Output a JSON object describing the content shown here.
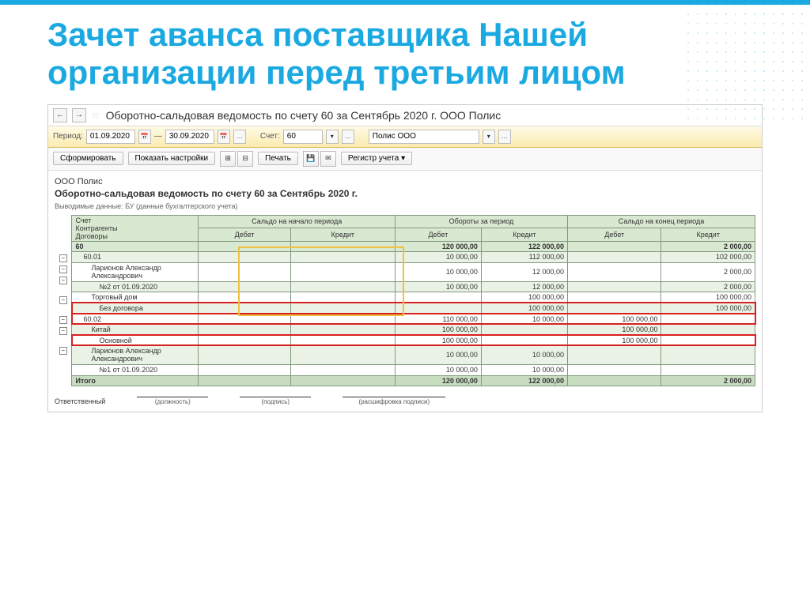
{
  "slide": {
    "title": "Зачет аванса поставщика Нашей организации перед третьим лицом"
  },
  "app": {
    "header_title": "Оборотно-сальдовая ведомость по счету 60 за Сентябрь 2020 г. ООО Полис",
    "nav_back": "←",
    "nav_fwd": "→",
    "star": "☆"
  },
  "toolbar": {
    "period_label": "Период:",
    "date_from": "01.09.2020",
    "date_sep": "—",
    "date_to": "30.09.2020",
    "account_label": "Счет:",
    "account": "60",
    "org": "Полис ООО",
    "btn_form": "Сформировать",
    "btn_settings": "Показать настройки",
    "btn_print": "Печать",
    "btn_register": "Регистр учета",
    "dots": "..."
  },
  "report": {
    "org": "ООО Полис",
    "title": "Оборотно-сальдовая ведомость по счету 60 за Сентябрь 2020 г.",
    "sub": "Выводимые данные: БУ (данные бухгалтерского учета)",
    "col_account": "Счет",
    "col_counterparty": "Контрагенты",
    "col_contracts": "Договоры",
    "grp_start": "Сальдо на начало периода",
    "grp_turn": "Обороты за период",
    "grp_end": "Сальдо на конец периода",
    "col_debit": "Дебет",
    "col_credit": "Кредит",
    "rows": [
      {
        "lvl": 0,
        "name": "60",
        "sd": "",
        "sc": "",
        "td": "120 000,00",
        "tc": "122 000,00",
        "ed": "",
        "ec": "2 000,00"
      },
      {
        "lvl": 1,
        "name": "60.01",
        "sd": "",
        "sc": "",
        "td": "10 000,00",
        "tc": "112 000,00",
        "ed": "",
        "ec": "102 000,00"
      },
      {
        "lvl": 2,
        "name": "Ларионов Александр Александрович",
        "sd": "",
        "sc": "",
        "td": "10 000,00",
        "tc": "12 000,00",
        "ed": "",
        "ec": "2 000,00"
      },
      {
        "lvl": 3,
        "name": "№2 от 01.09.2020",
        "sd": "",
        "sc": "",
        "td": "10 000,00",
        "tc": "12 000,00",
        "ed": "",
        "ec": "2 000,00"
      },
      {
        "lvl": 2,
        "name": "Торговый дом",
        "sd": "",
        "sc": "",
        "td": "",
        "tc": "100 000,00",
        "ed": "",
        "ec": "100 000,00"
      },
      {
        "lvl": 3,
        "name": "Без договора",
        "sd": "",
        "sc": "",
        "td": "",
        "tc": "100 000,00",
        "ed": "",
        "ec": "100 000,00",
        "hl": "red"
      },
      {
        "lvl": 1,
        "name": "60.02",
        "sd": "",
        "sc": "",
        "td": "110 000,00",
        "tc": "10 000,00",
        "ed": "100 000,00",
        "ec": "",
        "hl": "red"
      },
      {
        "lvl": 2,
        "name": "Китай",
        "sd": "",
        "sc": "",
        "td": "100 000,00",
        "tc": "",
        "ed": "100 000,00",
        "ec": ""
      },
      {
        "lvl": 3,
        "name": "Основной",
        "sd": "",
        "sc": "",
        "td": "100 000,00",
        "tc": "",
        "ed": "100 000,00",
        "ec": "",
        "hl": "red"
      },
      {
        "lvl": 2,
        "name": "Ларионов Александр Александрович",
        "sd": "",
        "sc": "",
        "td": "10 000,00",
        "tc": "10 000,00",
        "ed": "",
        "ec": ""
      },
      {
        "lvl": 3,
        "name": "№1 от 01.09.2020",
        "sd": "",
        "sc": "",
        "td": "10 000,00",
        "tc": "10 000,00",
        "ed": "",
        "ec": ""
      }
    ],
    "total_label": "Итого",
    "total": {
      "sd": "",
      "sc": "",
      "td": "120 000,00",
      "tc": "122 000,00",
      "ed": "",
      "ec": "2 000,00"
    },
    "sig_resp": "Ответственный",
    "sig_pos": "(должность)",
    "sig_sign": "(подпись)",
    "sig_decode": "(расшифровка подписи)"
  }
}
